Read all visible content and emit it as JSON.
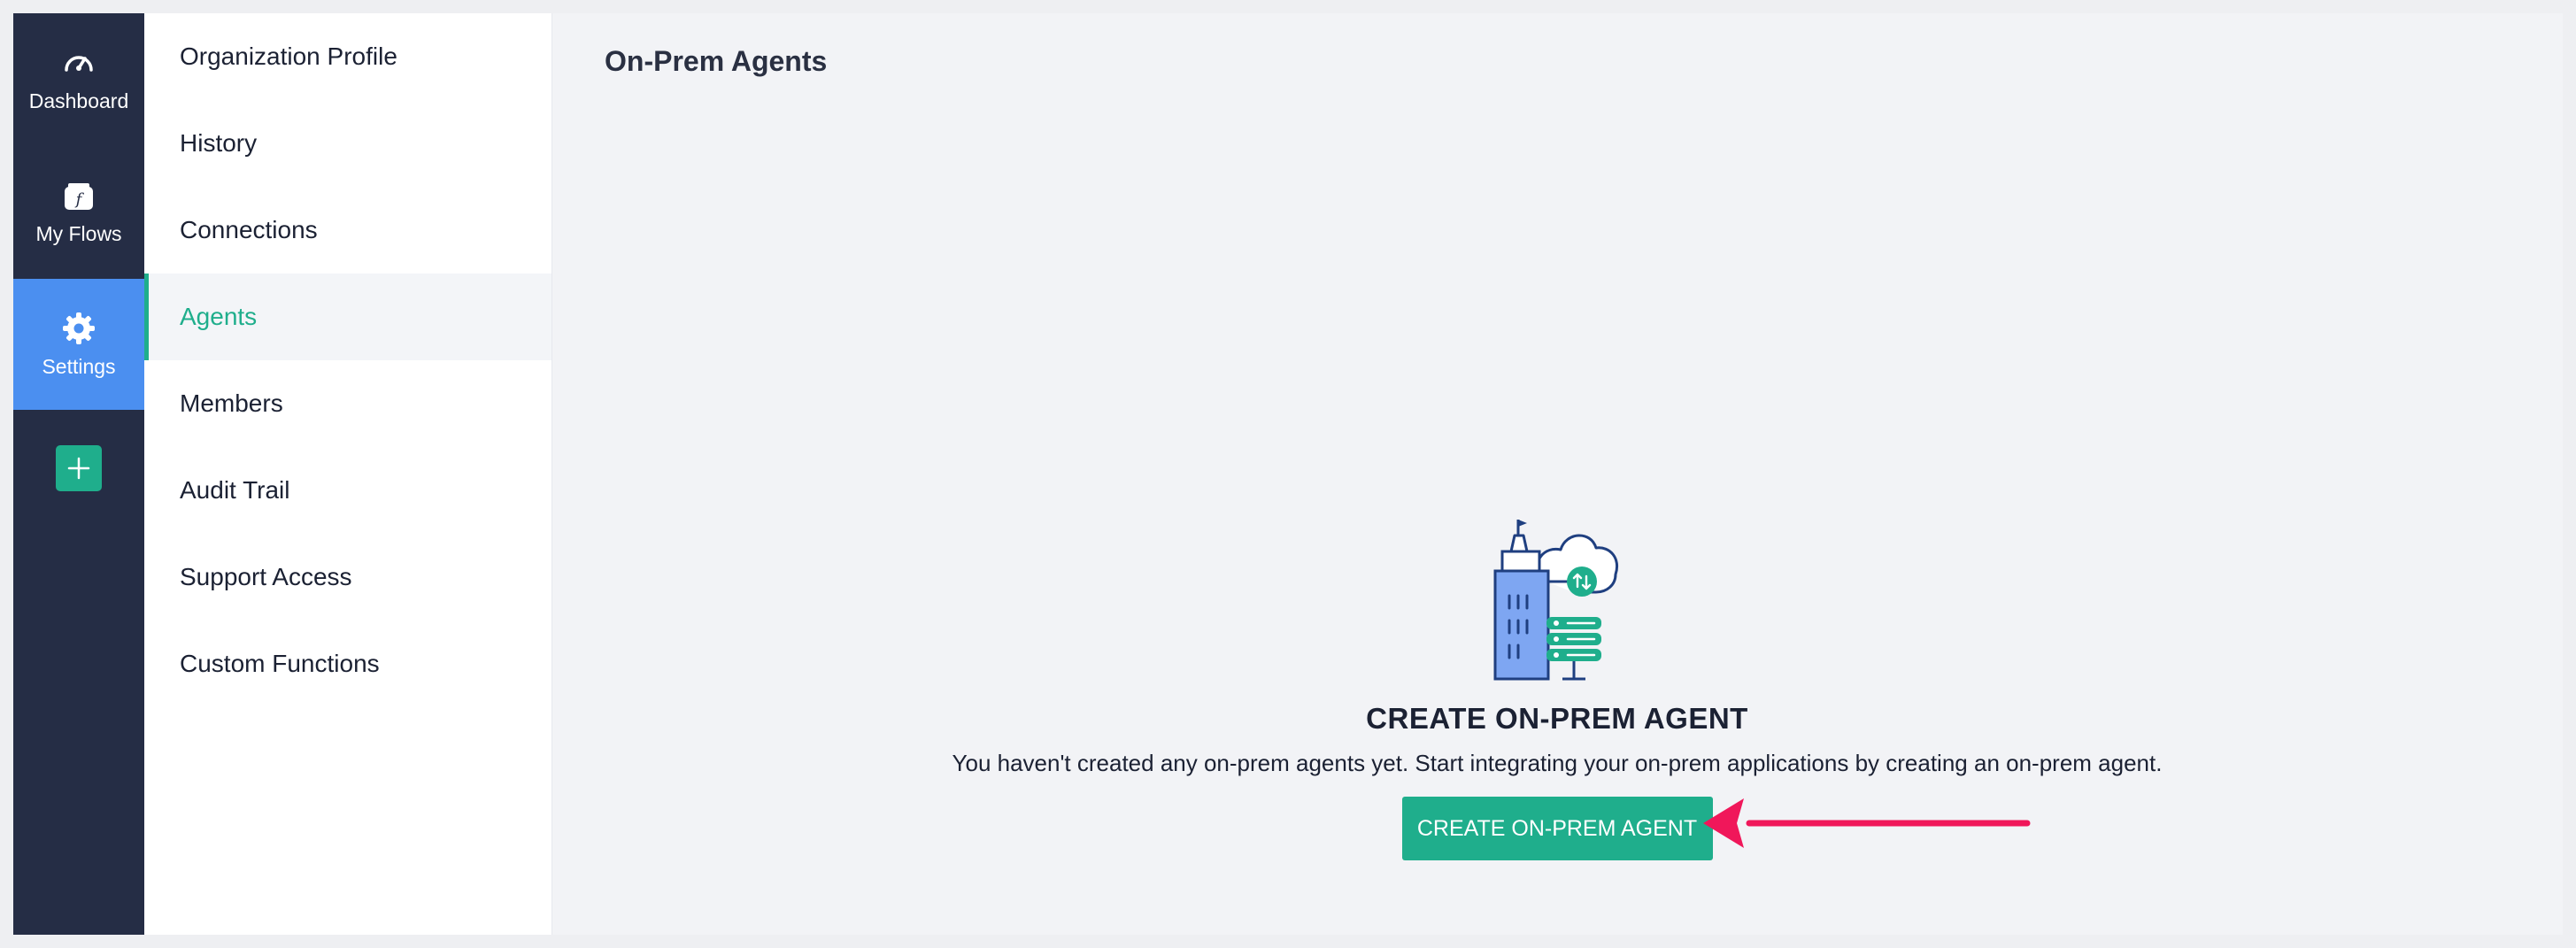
{
  "rail": {
    "items": [
      {
        "label": "Dashboard",
        "icon": "speedometer-icon"
      },
      {
        "label": "My Flows",
        "icon": "flows-icon"
      },
      {
        "label": "Settings",
        "icon": "gear-icon",
        "active": true
      }
    ],
    "add_icon": "plus-icon"
  },
  "menu": {
    "items": [
      {
        "label": "Organization Profile"
      },
      {
        "label": "History"
      },
      {
        "label": "Connections"
      },
      {
        "label": "Agents",
        "active": true
      },
      {
        "label": "Members"
      },
      {
        "label": "Audit Trail"
      },
      {
        "label": "Support Access"
      },
      {
        "label": "Custom Functions"
      }
    ]
  },
  "main": {
    "title": "On-Prem Agents",
    "empty_state": {
      "illustration": "building-cloud-server-illustration",
      "heading": "CREATE ON-PREM AGENT",
      "description": "You haven't created any on-prem agents yet. Start integrating your on-prem applications by creating an on-prem agent.",
      "button_label": "CREATE ON-PREM AGENT"
    },
    "annotation_arrow_color": "#f0175a"
  },
  "colors": {
    "rail_bg": "#252d45",
    "active_blue": "#4b8ff0",
    "accent_green": "#1fae8c"
  }
}
